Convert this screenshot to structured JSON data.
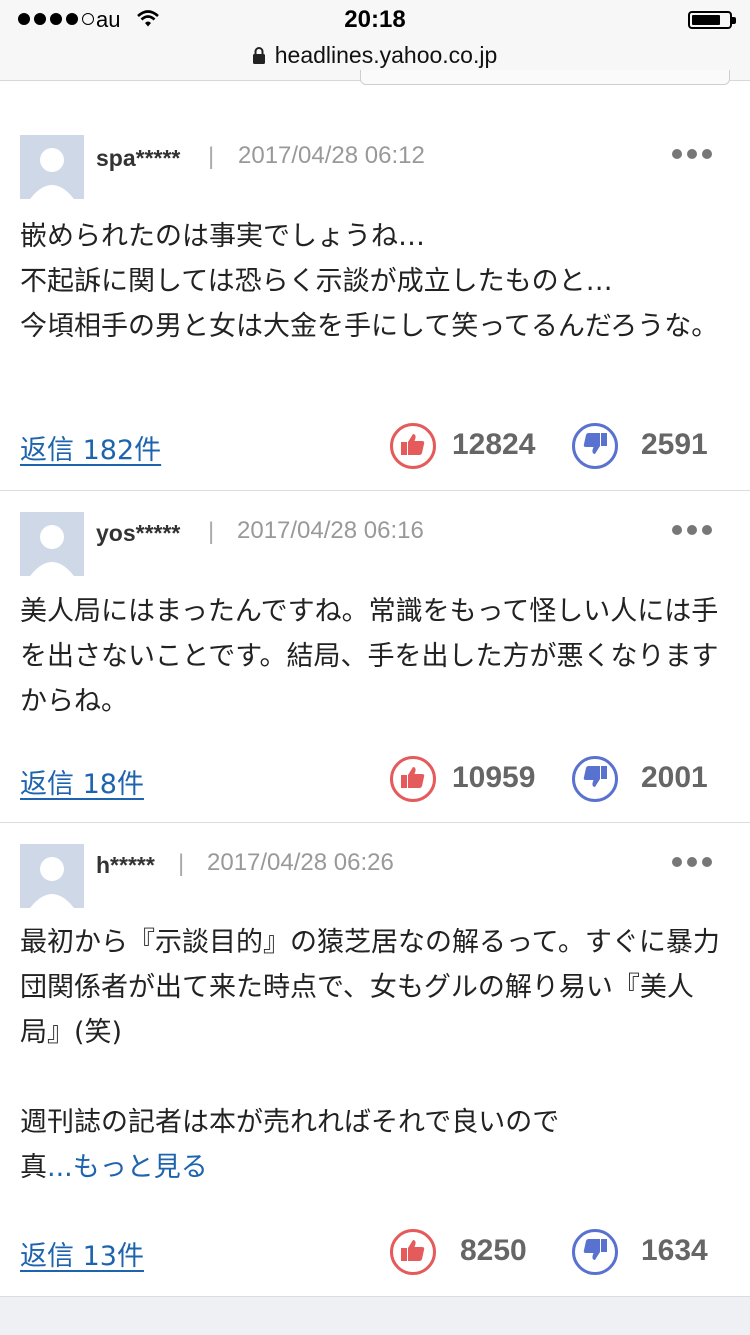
{
  "status_bar": {
    "carrier": "au",
    "time": "20:18",
    "signal_bars_filled": 4,
    "signal_bars_total": 5
  },
  "url_bar": {
    "domain": "headlines.yahoo.co.jp"
  },
  "comments": [
    {
      "username": "spa*****",
      "separator": "|",
      "date": "2017/04/28 06:12",
      "body": "嵌められたのは事実でしょうね…\n不起訴に関しては恐らく示談が成立したものと…\n今頃相手の男と女は大金を手にして笑ってるんだろうな。",
      "more_link": "",
      "reply": "返信 182件",
      "likes": "12824",
      "dislikes": "2591"
    },
    {
      "username": "yos*****",
      "separator": "|",
      "date": "2017/04/28 06:16",
      "body": "美人局にはまったんですね。常識をもって怪しい人には手を出さないことです。結局、手を出した方が悪くなりますからね。",
      "more_link": "",
      "reply": "返信 18件",
      "likes": "10959",
      "dislikes": "2001"
    },
    {
      "username": "h*****",
      "separator": "|",
      "date": "2017/04/28 06:26",
      "body": "最初から『示談目的』の猿芝居なの解るって。すぐに暴力団関係者が出て来た時点で、女もグルの解り易い『美人局』(笑)\n\n週刊誌の記者は本が売れればそれで良いので\n真",
      "more_link": "...もっと見る",
      "reply": "返信 13件",
      "likes": "8250",
      "dislikes": "1634"
    }
  ],
  "colors": {
    "link": "#1d63ad",
    "like": "#e55a5a",
    "dislike": "#5a72cf",
    "avatar_bg": "#cfd8e6"
  },
  "icons": [
    "signal-icon",
    "wifi-icon",
    "battery-icon",
    "lock-icon",
    "avatar-icon",
    "more-icon",
    "thumbs-up-icon",
    "thumbs-down-icon"
  ]
}
